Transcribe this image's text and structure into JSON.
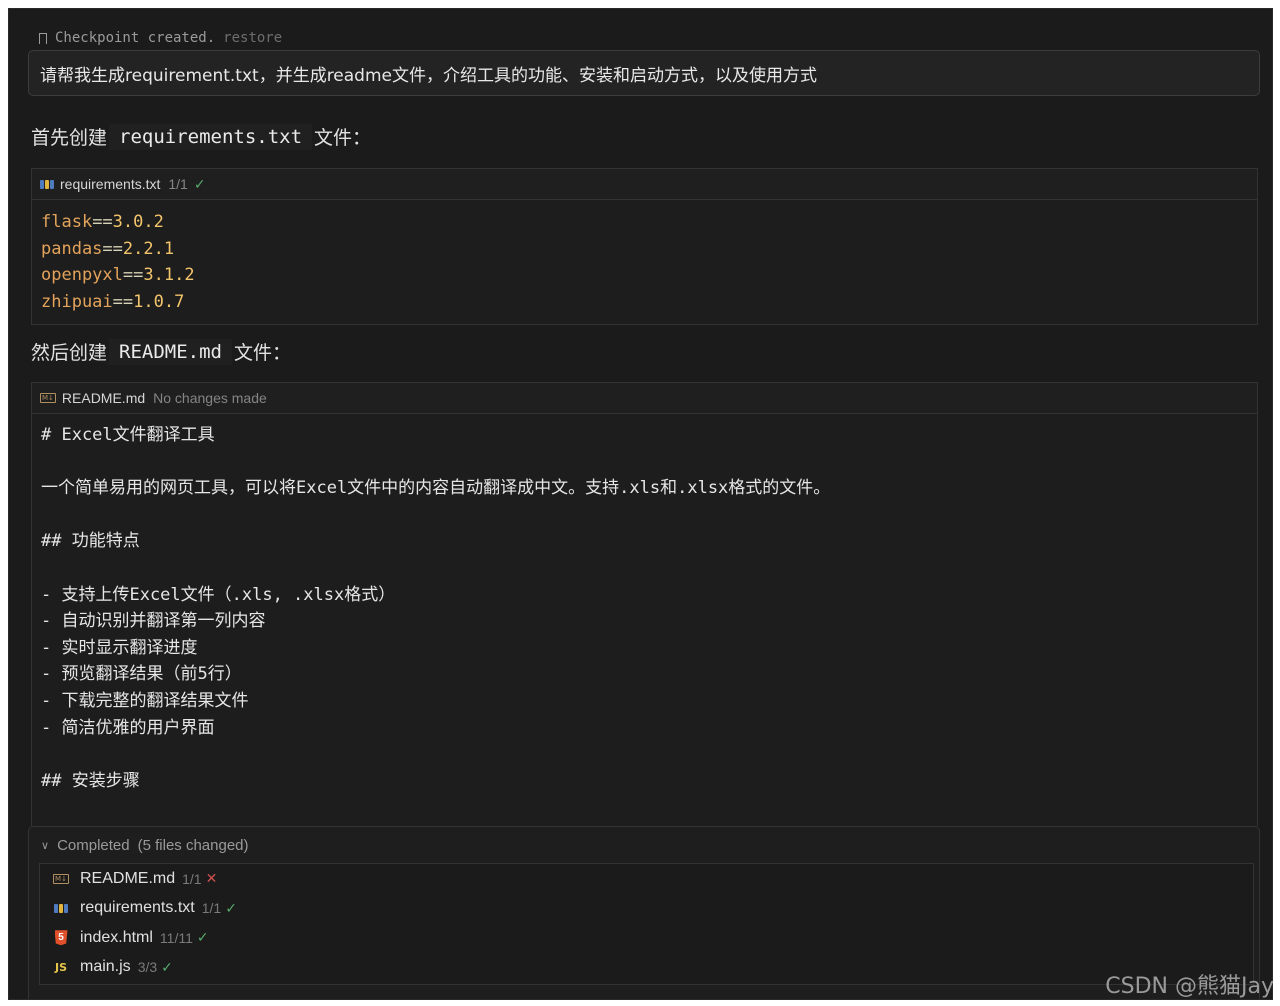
{
  "checkpoint": {
    "label": "Checkpoint created.",
    "restore": "restore"
  },
  "prompt": {
    "text": "请帮我生成requirement.txt，并生成readme文件，介绍工具的功能、安装和启动方式，以及使用方式"
  },
  "step1": {
    "prefix": "首先创建",
    "filename": "requirements.txt",
    "suffix": "文件："
  },
  "requirements_block": {
    "filename": "requirements.txt",
    "meta": "1/1",
    "status_icon": "check-icon",
    "lines": [
      {
        "pkg": "flask",
        "op": "==",
        "ver": "3.0.2"
      },
      {
        "pkg": "pandas",
        "op": "==",
        "ver": "2.2.1"
      },
      {
        "pkg": "openpyxl",
        "op": "==",
        "ver": "3.1.2"
      },
      {
        "pkg": "zhipuai",
        "op": "==",
        "ver": "1.0.7"
      }
    ]
  },
  "step2": {
    "prefix": "然后创建",
    "filename": "README.md",
    "suffix": "文件："
  },
  "readme_block": {
    "filename": "README.md",
    "meta": "No changes made",
    "lines": [
      "# Excel文件翻译工具",
      "",
      "一个简单易用的网页工具，可以将Excel文件中的内容自动翻译成中文。支持.xls和.xlsx格式的文件。",
      "",
      "## 功能特点",
      "",
      "- 支持上传Excel文件（.xls, .xlsx格式）",
      "- 自动识别并翻译第一列内容",
      "- 实时显示翻译进度",
      "- 预览翻译结果（前5行）",
      "- 下载完整的翻译结果文件",
      "- 简洁优雅的用户界面",
      "",
      "## 安装步骤"
    ]
  },
  "completed": {
    "title": "Completed",
    "count": "(5 files changed)",
    "files": [
      {
        "name": "README.md",
        "meta": "1/1",
        "status": "✕",
        "icon": "markdown-icon"
      },
      {
        "name": "requirements.txt",
        "meta": "1/1",
        "status": "✓",
        "icon": "pip-icon"
      },
      {
        "name": "index.html",
        "meta": "11/11",
        "status": "✓",
        "icon": "html5-icon"
      },
      {
        "name": "main.js",
        "meta": "3/3",
        "status": "✓",
        "icon": "js-icon"
      }
    ]
  },
  "watermark": "CSDN @熊猫Jay",
  "colors": {
    "background": "#1b1b1b",
    "package": "#e3a35a",
    "version": "#f2c46b",
    "check": "#59a96a",
    "cross": "#d05050"
  }
}
